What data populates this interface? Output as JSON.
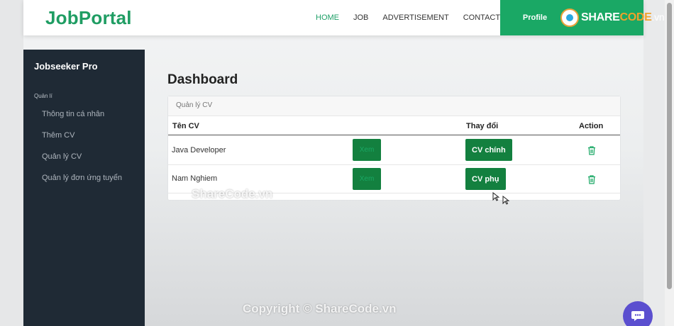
{
  "navbar": {
    "logo": "JobPortal",
    "links": [
      "HOME",
      "JOB",
      "ADVERTISEMENT",
      "CONTACT"
    ],
    "active_link": "HOME",
    "profile_label": "Profile",
    "brand_color": "#1aa865"
  },
  "watermark_logo": {
    "part1": "SHARE",
    "part2": "CODE",
    "part3": ".vn"
  },
  "sidebar": {
    "title": "Jobseeker Pro",
    "section": "Quản lí",
    "items": [
      {
        "label": "Thông tin cá nhân"
      },
      {
        "label": "Thêm CV"
      },
      {
        "label": "Quản lý CV"
      },
      {
        "label": "Quản lý đơn ứng tuyển"
      }
    ]
  },
  "main": {
    "title": "Dashboard",
    "card_header": "Quản lý CV",
    "table": {
      "columns": [
        "Tên CV",
        "Thay đổi",
        "Action"
      ],
      "rows": [
        {
          "name": "Java Developer",
          "view_label": "Xem",
          "change_label": "CV chính",
          "action_icon": "trash-icon"
        },
        {
          "name": "Nam Nghiem",
          "view_label": "Xem",
          "change_label": "CV phụ",
          "action_icon": "trash-icon"
        }
      ]
    }
  },
  "overlay_watermarks": {
    "middle": "ShareCode.vn",
    "bottom": "Copyright © ShareCode.vn"
  },
  "chat_icon": "chat-bubble-icon"
}
